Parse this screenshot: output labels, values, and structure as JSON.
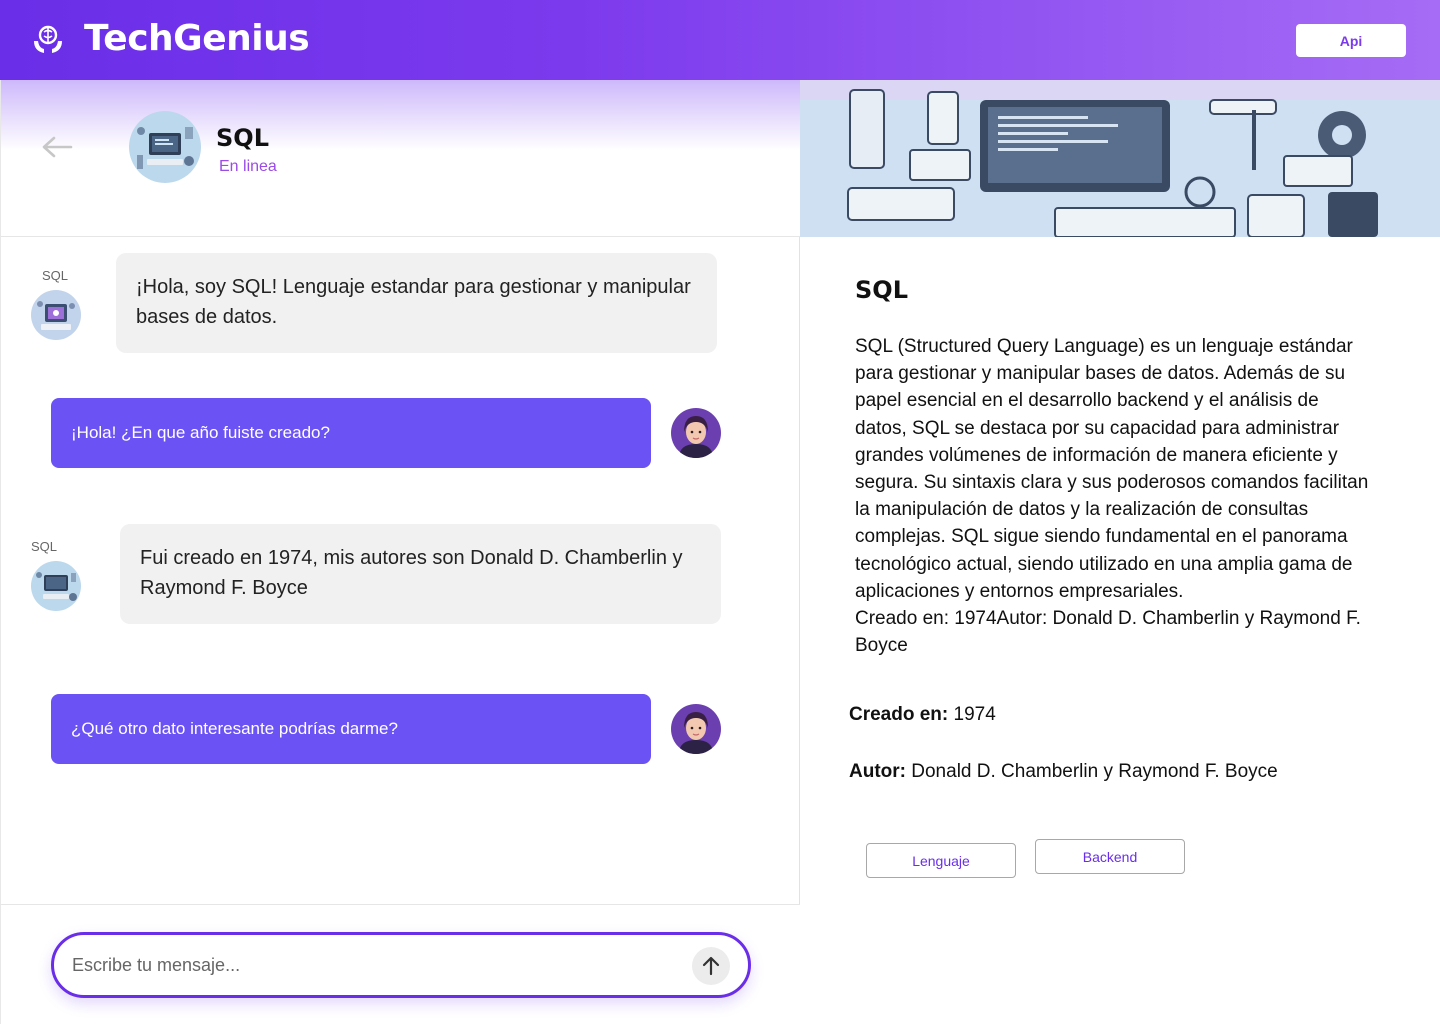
{
  "header": {
    "brand_name": "TechGenius",
    "api_button": "Api",
    "gradient_start": "#6a2ee8",
    "gradient_end": "#a66cf5"
  },
  "chat": {
    "title": "SQL",
    "status": "En linea",
    "messages": [
      {
        "sender": "bot",
        "label": "SQL",
        "text": "¡Hola, soy SQL! Lenguaje estandar para gestionar y manipular bases de datos."
      },
      {
        "sender": "user",
        "text": "¡Hola! ¿En que año fuiste creado?"
      },
      {
        "sender": "bot",
        "label": "SQL",
        "text": "Fui creado en 1974, mis autores son Donald D. Chamberlin y Raymond F. Boyce"
      },
      {
        "sender": "user",
        "text": "¿Qué otro dato interesante podrías darme?"
      }
    ],
    "composer_placeholder": "Escribe tu mensaje...",
    "bot_bubble_color": "#f1f1f1",
    "user_bubble_color": "#6b52f5"
  },
  "info": {
    "title": "SQL",
    "description": "SQL (Structured Query Language) es un lenguaje estándar para gestionar y manipular bases de datos. Además de su papel esencial en el desarrollo backend y el análisis de datos, SQL se destaca por su capacidad para administrar grandes volúmenes de información de manera eficiente y segura. Su sintaxis clara y sus poderosos comandos facilitan la manipulación de datos y la realización de consultas complejas. SQL sigue siendo fundamental en el panorama tecnológico actual, siendo utilizado en una amplia gama de aplicaciones y entornos empresariales.",
    "description_footer": "Creado en: 1974Autor: Donald D. Chamberlin y Raymond F. Boyce",
    "created_label": "Creado en:",
    "created_value": "1974",
    "author_label": "Autor:",
    "author_value": "Donald D. Chamberlin y Raymond F. Boyce",
    "tags": [
      "Lenguaje",
      "Backend"
    ]
  }
}
